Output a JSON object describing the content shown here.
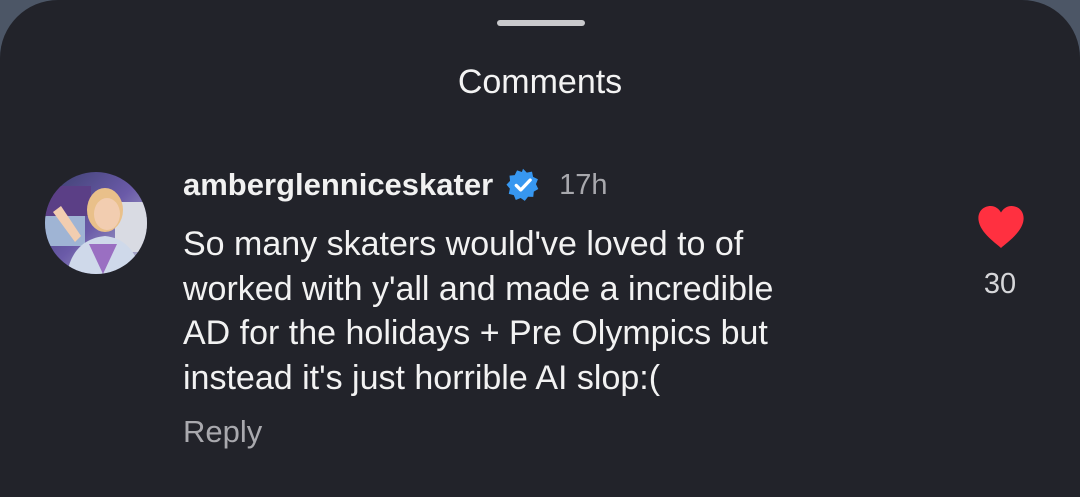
{
  "sheet": {
    "title": "Comments"
  },
  "comment": {
    "username": "amberglenniceskater",
    "verified": true,
    "time": "17h",
    "body_lines": [
      "So many skaters would've loved to of",
      "worked with y'all and made a incredible",
      "AD for the holidays + Pre Olympics but",
      "instead it's just horrible AI slop:("
    ],
    "reply_label": "Reply",
    "like_count": "30",
    "liked": true
  },
  "colors": {
    "background": "#22232a",
    "text": "#f2f2f2",
    "muted": "#a9a9ae",
    "verified_blue": "#3797f0",
    "like_red": "#ff3040"
  },
  "icons": {
    "verified": "verified-badge-icon",
    "like": "heart-icon",
    "grabber": "drag-handle"
  }
}
